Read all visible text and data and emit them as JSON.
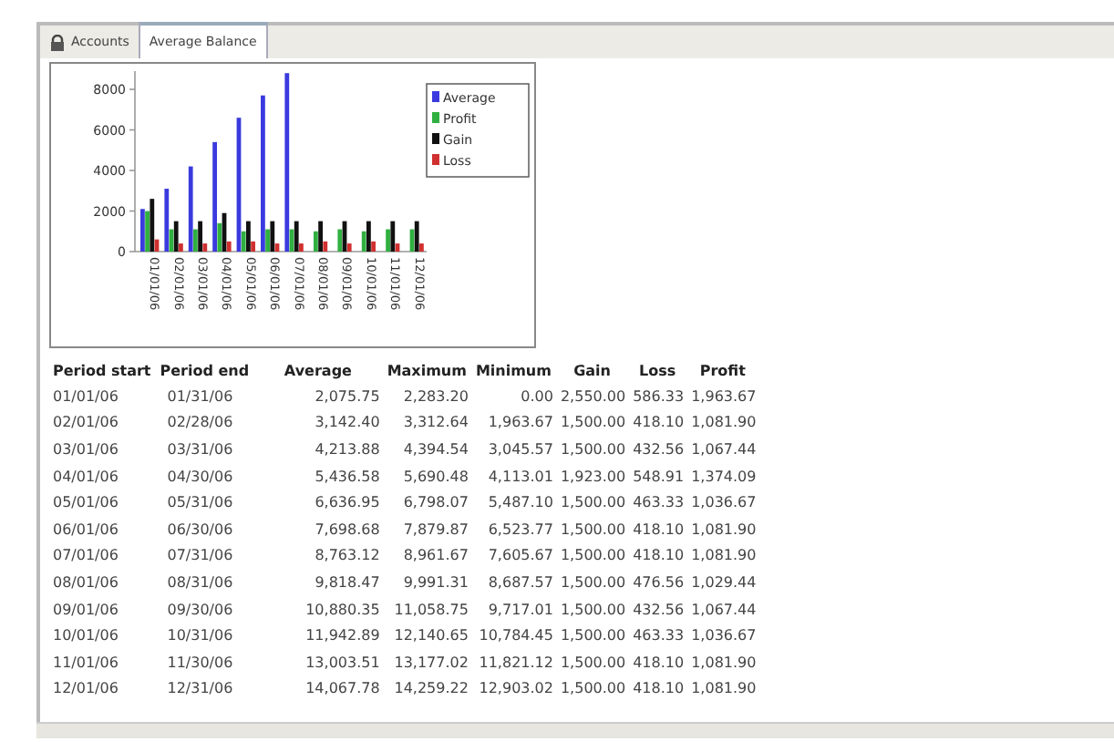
{
  "tabs": [
    {
      "label": "Accounts",
      "selected": false
    },
    {
      "label": "Average Balance",
      "selected": true
    }
  ],
  "chart": {
    "chart_data": {
      "type": "bar",
      "categories": [
        "01/01/06",
        "02/01/06",
        "03/01/06",
        "04/01/06",
        "05/01/06",
        "06/01/06",
        "07/01/06",
        "08/01/06",
        "09/01/06",
        "10/01/06",
        "11/01/06",
        "12/01/06"
      ],
      "series": [
        {
          "name": "Average",
          "color": "#3a3adf",
          "values": [
            2100,
            3100,
            4200,
            5400,
            6600,
            7700,
            8800,
            null,
            null,
            null,
            null,
            null
          ]
        },
        {
          "name": "Profit",
          "color": "#30b040",
          "values": [
            2000,
            1100,
            1100,
            1400,
            1000,
            1100,
            1100,
            1000,
            1100,
            1000,
            1100,
            1100
          ]
        },
        {
          "name": "Gain",
          "color": "#111111",
          "values": [
            2600,
            1500,
            1500,
            1900,
            1500,
            1500,
            1500,
            1500,
            1500,
            1500,
            1500,
            1500
          ]
        },
        {
          "name": "Loss",
          "color": "#d03030",
          "values": [
            600,
            400,
            400,
            500,
            500,
            400,
            400,
            500,
            400,
            500,
            400,
            400
          ]
        }
      ],
      "ylim": [
        0,
        8900
      ],
      "yticks": [
        0,
        2000,
        4000,
        6000,
        8000
      ],
      "legend": true
    }
  },
  "table": {
    "columns": [
      "Period start",
      "Period end",
      "Average",
      "Maximum",
      "Minimum",
      "Gain",
      "Loss",
      "Profit"
    ],
    "rows": [
      [
        "01/01/06",
        "01/31/06",
        "2,075.75",
        "2,283.20",
        "0.00",
        "2,550.00",
        "586.33",
        "1,963.67"
      ],
      [
        "02/01/06",
        "02/28/06",
        "3,142.40",
        "3,312.64",
        "1,963.67",
        "1,500.00",
        "418.10",
        "1,081.90"
      ],
      [
        "03/01/06",
        "03/31/06",
        "4,213.88",
        "4,394.54",
        "3,045.57",
        "1,500.00",
        "432.56",
        "1,067.44"
      ],
      [
        "04/01/06",
        "04/30/06",
        "5,436.58",
        "5,690.48",
        "4,113.01",
        "1,923.00",
        "548.91",
        "1,374.09"
      ],
      [
        "05/01/06",
        "05/31/06",
        "6,636.95",
        "6,798.07",
        "5,487.10",
        "1,500.00",
        "463.33",
        "1,036.67"
      ],
      [
        "06/01/06",
        "06/30/06",
        "7,698.68",
        "7,879.87",
        "6,523.77",
        "1,500.00",
        "418.10",
        "1,081.90"
      ],
      [
        "07/01/06",
        "07/31/06",
        "8,763.12",
        "8,961.67",
        "7,605.67",
        "1,500.00",
        "418.10",
        "1,081.90"
      ],
      [
        "08/01/06",
        "08/31/06",
        "9,818.47",
        "9,991.31",
        "8,687.57",
        "1,500.00",
        "476.56",
        "1,029.44"
      ],
      [
        "09/01/06",
        "09/30/06",
        "10,880.35",
        "11,058.75",
        "9,717.01",
        "1,500.00",
        "432.56",
        "1,067.44"
      ],
      [
        "10/01/06",
        "10/31/06",
        "11,942.89",
        "12,140.65",
        "10,784.45",
        "1,500.00",
        "463.33",
        "1,036.67"
      ],
      [
        "11/01/06",
        "11/30/06",
        "13,003.51",
        "13,177.02",
        "11,821.12",
        "1,500.00",
        "418.10",
        "1,081.90"
      ],
      [
        "12/01/06",
        "12/31/06",
        "14,067.78",
        "14,259.22",
        "12,903.02",
        "1,500.00",
        "418.10",
        "1,081.90"
      ]
    ]
  }
}
